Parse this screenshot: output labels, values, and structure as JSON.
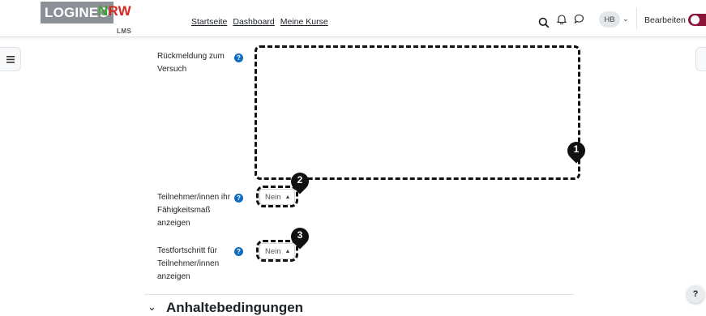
{
  "logo": {
    "main": "LOGINEO",
    "nrw_n": "N",
    "nrw_rw": "RW",
    "sub": "LMS"
  },
  "nav": {
    "links": [
      "Startseite",
      "Dashboard",
      "Meine Kurse"
    ]
  },
  "user": {
    "initials": "HB"
  },
  "edit_mode": {
    "label": "Bearbeiten",
    "on": true
  },
  "form": {
    "feedback_label": "Rückmeldung zum Versuch",
    "ability_label": "Teilnehmer/innen ihr Fähigkeitsmaß anzeigen",
    "ability_value": "Nein",
    "progress_label": "Testfortschritt für Teilnehmer/innen anzeigen",
    "progress_value": "Nein"
  },
  "markers": [
    "1",
    "2",
    "3"
  ],
  "section": {
    "title": "Anhaltebedingungen"
  },
  "help_fab": "?",
  "colors": {
    "brand_green": "#3aa135",
    "brand_red": "#d7261f",
    "toggle": "#8a1538",
    "help": "#0f6cbf"
  }
}
